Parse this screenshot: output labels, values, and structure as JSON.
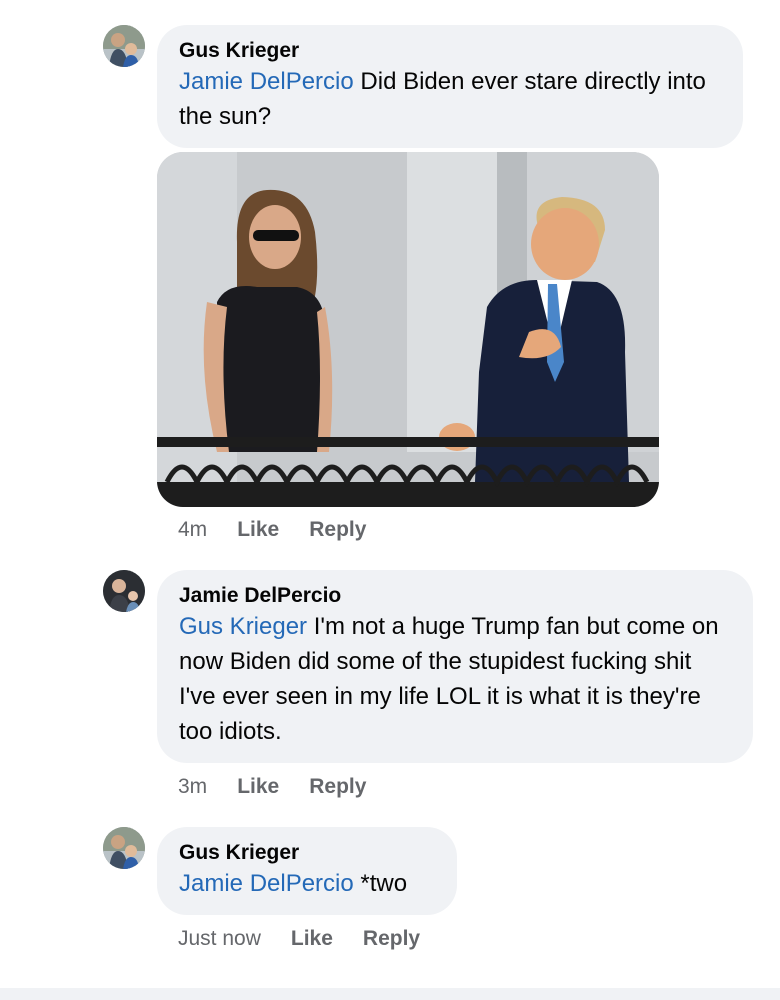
{
  "comments": [
    {
      "author": "Gus Krieger",
      "mention": "Jamie DelPercio",
      "text": " Did Biden ever stare directly into the sun?",
      "time": "4m",
      "like_label": "Like",
      "reply_label": "Reply"
    },
    {
      "author": "Jamie DelPercio",
      "mention": "Gus Krieger",
      "text": " I'm not a huge Trump fan but come on now Biden did some of the stupidest fucking shit I've ever seen in my life LOL it is what it is they're too idiots.",
      "time": "3m",
      "like_label": "Like",
      "reply_label": "Reply"
    },
    {
      "author": "Gus Krieger",
      "mention": "Jamie DelPercio",
      "text": " *two",
      "time": "Just now",
      "like_label": "Like",
      "reply_label": "Reply"
    }
  ],
  "colors": {
    "bubble": "#f0f2f5",
    "mention": "#2469b7",
    "meta": "#65676b"
  }
}
